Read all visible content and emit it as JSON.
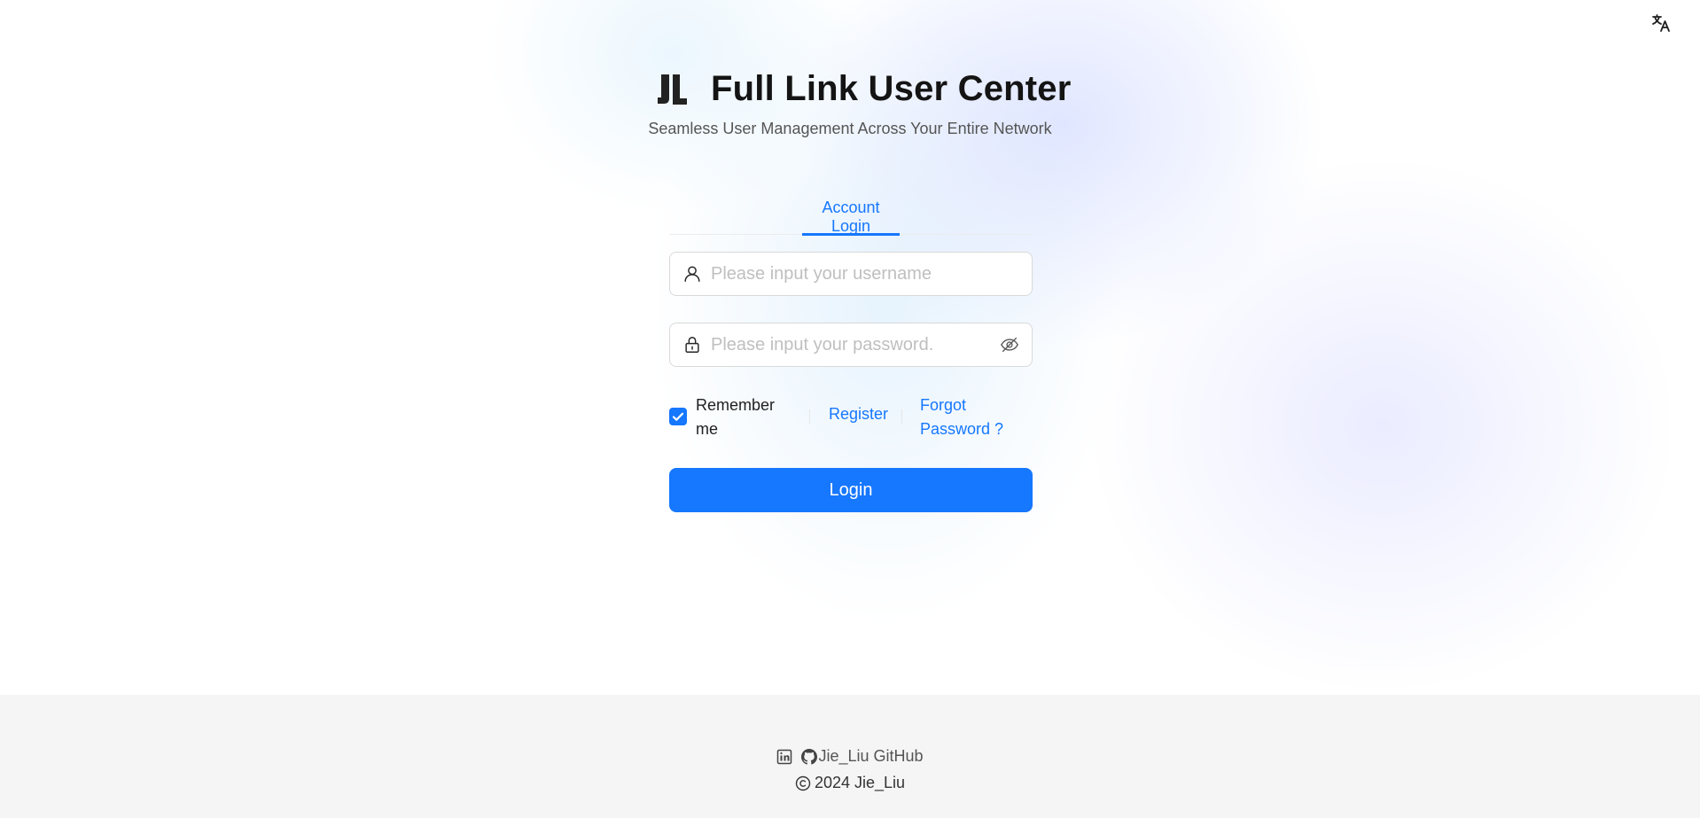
{
  "header": {
    "title": "Full Link User Center",
    "subtitle": "Seamless User Management Across Your Entire Network",
    "logo_icon": "jl-logo-icon"
  },
  "language_button": {
    "icon": "translate-icon"
  },
  "tabs": [
    {
      "label": "Account Login",
      "active": true
    }
  ],
  "form": {
    "username": {
      "value": "",
      "placeholder": "Please input your username",
      "icon": "user-icon"
    },
    "password": {
      "value": "",
      "placeholder": "Please input your password.",
      "icon": "lock-icon",
      "toggle_icon": "eye-invisible-icon"
    },
    "remember_label": "Remember me",
    "remember_checked": true,
    "register_label": "Register",
    "forgot_label": "Forgot Password ?",
    "login_label": "Login"
  },
  "footer": {
    "github_label": "Jie_Liu GitHub",
    "copyright": "2024 Jie_Liu",
    "icons": [
      "linkedin-icon",
      "github-icon",
      "copyright-icon"
    ]
  },
  "colors": {
    "primary": "#1677ff",
    "footer_bg": "#f5f5f5",
    "title": "#141414"
  }
}
